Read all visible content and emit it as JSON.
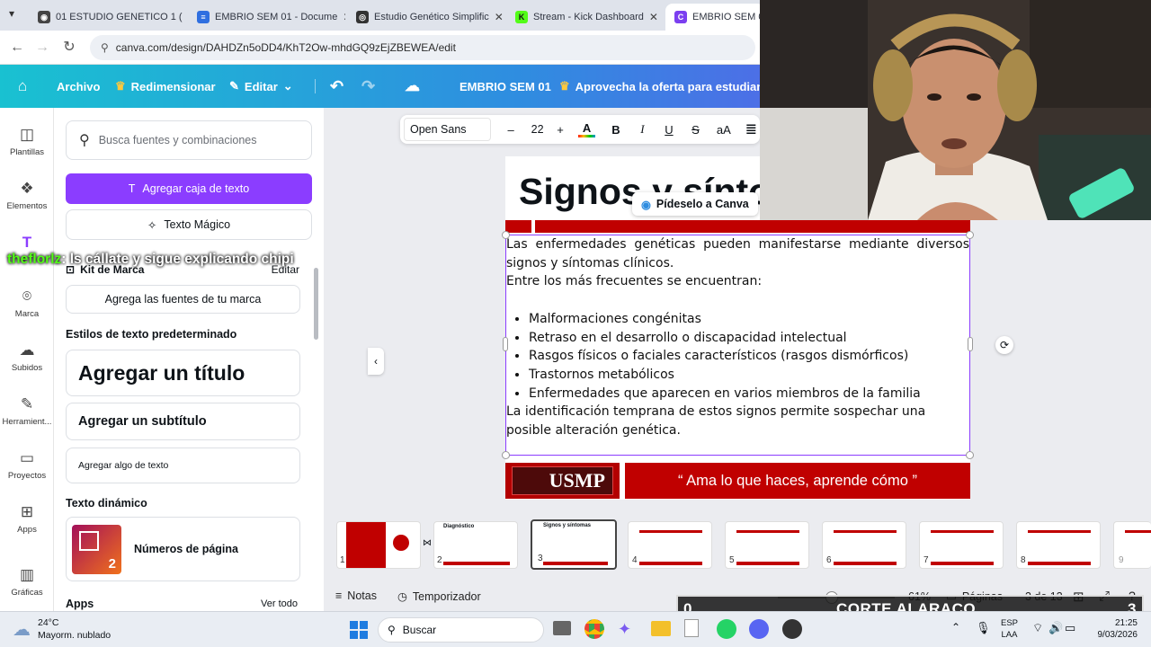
{
  "browser": {
    "tabs": [
      {
        "title": "01 ESTUDIO GENETICO 1 (",
        "fav_color": "#444",
        "fav_glyph": "◉"
      },
      {
        "title": "EMBRIO SEM 01 - Docume",
        "fav_color": "#2f6fe0",
        "fav_glyph": "≡"
      },
      {
        "title": "Estudio Genético Simplific",
        "fav_color": "#333",
        "fav_glyph": "◎"
      },
      {
        "title": "Stream - Kick Dashboard",
        "fav_color": "#53fc18",
        "fav_glyph": "K"
      },
      {
        "title": "EMBRIO SEM 01",
        "fav_color": "#7b3ff0",
        "fav_glyph": "C"
      }
    ],
    "url": "canva.com/design/DAHDZn5oDD4/KhT2Ow-mhdGQ9zEjZBEWEA/edit"
  },
  "canva_header": {
    "archivo": "Archivo",
    "redimensionar": "Redimensionar",
    "editar": "Editar",
    "doc_title": "EMBRIO SEM 01",
    "promo": "Aprovecha la oferta para estudian"
  },
  "rail": [
    {
      "label": "Plantillas",
      "icon": "◫"
    },
    {
      "label": "Elementos",
      "icon": "❖"
    },
    {
      "label": "",
      "icon": "T"
    },
    {
      "label": "Marca",
      "icon": "⌾"
    },
    {
      "label": "Subidos",
      "icon": "☁"
    },
    {
      "label": "Herramient...",
      "icon": "✎"
    },
    {
      "label": "Proyectos",
      "icon": "▭"
    },
    {
      "label": "Apps",
      "icon": "⊞"
    },
    {
      "label": "Gráficas",
      "icon": "▥"
    }
  ],
  "panel": {
    "search_placeholder": "Busca fuentes y combinaciones",
    "add_textbox": "Agregar caja de texto",
    "magic_text": "Texto Mágico",
    "chat_user": "theflorlz",
    "chat_msg": ": ls cállate y sigue explicando chipi",
    "kit_label": "Kit de Marca",
    "kit_edit": "Editar",
    "add_brand_fonts": "Agrega las fuentes de tu marca",
    "default_styles": "Estilos de texto predeterminado",
    "add_title": "Agregar un título",
    "add_subtitle": "Agregar un subtítulo",
    "add_body": "Agregar algo de texto",
    "dynamic_text": "Texto dinámico",
    "page_numbers": "Números de página",
    "page_num_sample": "2",
    "apps": "Apps",
    "see_all": "Ver todo"
  },
  "toolbar": {
    "font": "Open Sans",
    "size": "22",
    "minus": "–",
    "plus": "+",
    "bold": "B",
    "italic": "I",
    "underline": "U",
    "strike": "S",
    "case": "aA"
  },
  "slide": {
    "title": "Signos y sínto",
    "ask_canva": "Pídeselo a Canva",
    "intro": "Las enfermedades genéticas pueden manifestarse mediante diversos signos y síntomas clínicos.",
    "lead": "Entre los más frecuentes se encuentran:",
    "bullets": [
      "Malformaciones congénitas",
      "Retraso en el desarrollo o discapacidad intelectual",
      "Rasgos físicos o faciales característicos (rasgos dismórficos)",
      "Trastornos metabólicos",
      "Enfermedades que aparecen en varios miembros de la familia"
    ],
    "closing": "La identificación temprana de estos signos permite sospechar una posible alteración genética.",
    "logo": "USMP",
    "motto": "“ Ama lo que haces, aprende cómo ”"
  },
  "thumbnails": [
    {
      "num": "1",
      "title": ""
    },
    {
      "num": "2",
      "title": "Diagnóstico"
    },
    {
      "num": "3",
      "title": "Signos y síntomas"
    },
    {
      "num": "4",
      "title": ""
    },
    {
      "num": "5",
      "title": ""
    },
    {
      "num": "6",
      "title": ""
    },
    {
      "num": "7",
      "title": ""
    },
    {
      "num": "8",
      "title": ""
    },
    {
      "num": "9",
      "title": ""
    }
  ],
  "bottombar": {
    "notes": "Notas",
    "timer": "Temporizador",
    "zoom": "61%",
    "pages": "Páginas",
    "page_count": "3 de 13"
  },
  "overlay": {
    "score_left": "0",
    "score_label": "CORTE ALARACO",
    "score_right": "3"
  },
  "taskbar": {
    "temp": "24°C",
    "weather": "Mayorm. nublado",
    "search": "Buscar",
    "lang1": "ESP",
    "lang2": "LAA",
    "time": "21:25",
    "date": "9/03/2026"
  },
  "colors": {
    "accent_purple": "#8b3dff",
    "slide_red": "#c00000"
  }
}
